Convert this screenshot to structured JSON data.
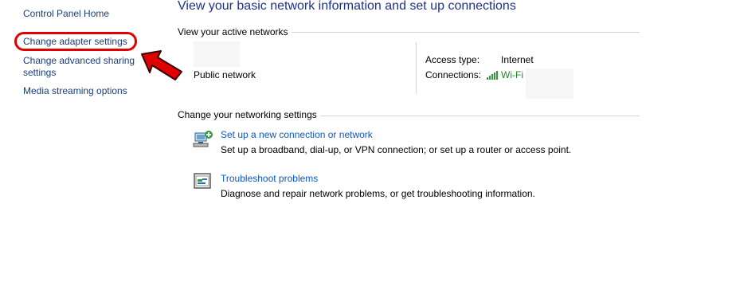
{
  "sidebar": {
    "items": [
      {
        "label": "Control Panel Home"
      },
      {
        "label": "Change adapter settings"
      },
      {
        "label": "Change advanced sharing settings",
        "line1": "Change advanced sharing",
        "line2": "settings"
      },
      {
        "label": "Media streaming options"
      }
    ]
  },
  "main": {
    "title": "View your basic network information and set up connections",
    "active_networks": {
      "heading": "View your active networks",
      "network_name_type": "Public network",
      "access_type_label": "Access type:",
      "access_type_value": "Internet",
      "connections_label": "Connections:",
      "connections_value": "Wi-Fi",
      "connections_icon": "wifi-signal-icon"
    },
    "settings": {
      "heading": "Change your networking settings",
      "items": [
        {
          "icon": "new-connection-icon",
          "link": "Set up a new connection or network",
          "description": "Set up a broadband, dial-up, or VPN connection; or set up a router or access point."
        },
        {
          "icon": "troubleshoot-icon",
          "link": "Troubleshoot problems",
          "description": "Diagnose and repair network problems, or get troubleshooting information."
        }
      ]
    }
  },
  "annotation": {
    "highlight_color": "#e00000",
    "arrow_icon": "red-arrow-icon"
  }
}
